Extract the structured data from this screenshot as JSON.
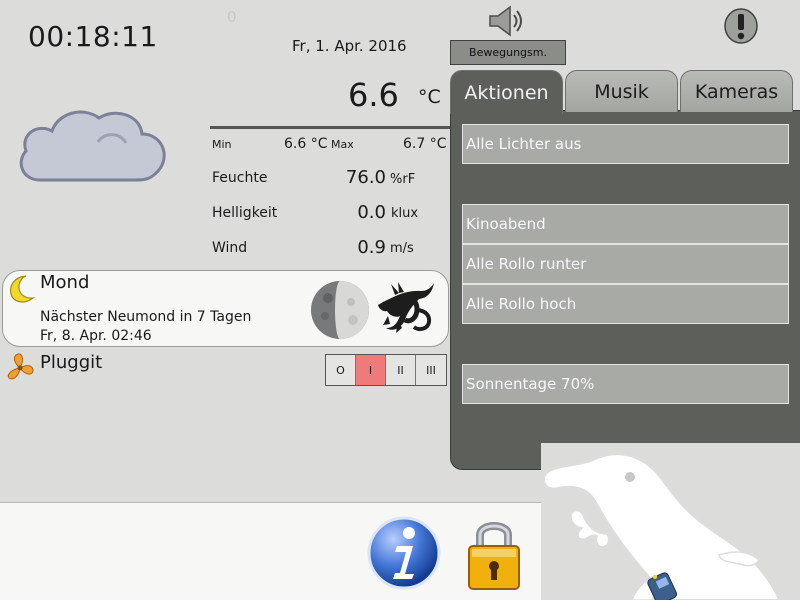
{
  "header": {
    "time": "00:18:11",
    "dim_counter": "0",
    "date": "Fr, 1. Apr. 2016",
    "motion_mode_label": "Bewegungsm.",
    "icons": [
      "speaker-icon",
      "alert-icon"
    ]
  },
  "weather": {
    "condition_icon": "cloud-icon",
    "temperature": "6.6",
    "temperature_unit": "°C",
    "min_label": "Min",
    "min_value": "6.6 °C",
    "max_label": "Max",
    "max_value": "6.7 °C",
    "metrics": [
      {
        "label": "Feuchte",
        "value": "76.0",
        "unit": "%rF"
      },
      {
        "label": "Helligkeit",
        "value": "0.0",
        "unit": "klux"
      },
      {
        "label": "Wind",
        "value": "0.9",
        "unit": "m/s"
      }
    ]
  },
  "moon": {
    "title": "Mond",
    "next_new_moon": "Nächster Neumond in 7 Tagen",
    "next_new_moon_date": "Fr, 8. Apr. 02:46",
    "zodiac_icon": "capricorn-icon"
  },
  "pluggit": {
    "title": "Pluggit",
    "levels": [
      "O",
      "I",
      "II",
      "III"
    ],
    "active_level": "I",
    "active_color": "#ee7a7a"
  },
  "tabs": [
    {
      "label": "Aktionen",
      "active": true
    },
    {
      "label": "Musik",
      "active": false
    },
    {
      "label": "Kameras",
      "active": false
    }
  ],
  "actions": [
    {
      "label": "Alle Lichter aus"
    },
    {
      "label": "Kinoabend"
    },
    {
      "label": "Alle Rollo runter"
    },
    {
      "label": "Alle Rollo hoch"
    },
    {
      "label": "Sonnentage 70%"
    }
  ],
  "footer": {
    "icons": [
      "info-icon",
      "lock-icon",
      "gecko-logo"
    ]
  },
  "colors": {
    "background": "#dcdcda",
    "panel": "#5c5f5a",
    "action_button": "#a8aaa6",
    "info_blue": "#2d5fbf",
    "lock_gold": "#f0b10d"
  }
}
